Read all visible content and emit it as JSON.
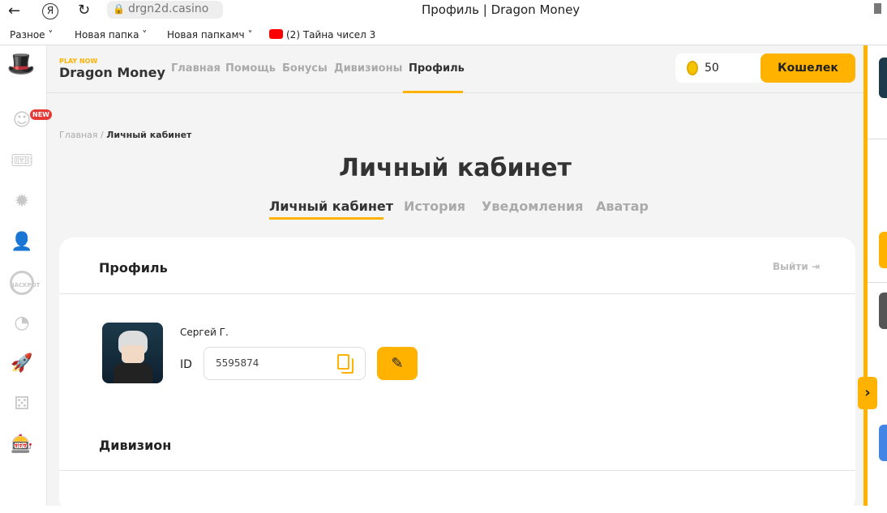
{
  "browser": {
    "url": "drgn2d.casino",
    "title": "Профиль | Dragon Money",
    "bookmarks": [
      "Разное",
      "Новая папка",
      "Новая папкамч",
      "(2) Тайна чисел 3"
    ]
  },
  "header": {
    "play_now": "PLAY NOW",
    "brand": "Dragon Money",
    "nav": [
      "Главная",
      "Помощь",
      "Бонусы",
      "Дивизионы",
      "Профиль"
    ],
    "balance": "50",
    "wallet": "Кошелек"
  },
  "sidebar": {
    "new_badge": "NEW",
    "jackpot": "JACKPOT"
  },
  "breadcrumb": {
    "home": "Главная",
    "sep": "/",
    "current": "Личный кабинет"
  },
  "page": {
    "title": "Личный кабинет",
    "tabs": [
      "Личный кабинет",
      "История",
      "Уведомления",
      "Аватар"
    ]
  },
  "profile": {
    "section": "Профиль",
    "logout": "Выйти",
    "name": "Сергей Г.",
    "id_label": "ID",
    "id_value": "5595874"
  },
  "division": {
    "section": "Дивизион"
  },
  "colors": {
    "accent": "#ffb300"
  }
}
